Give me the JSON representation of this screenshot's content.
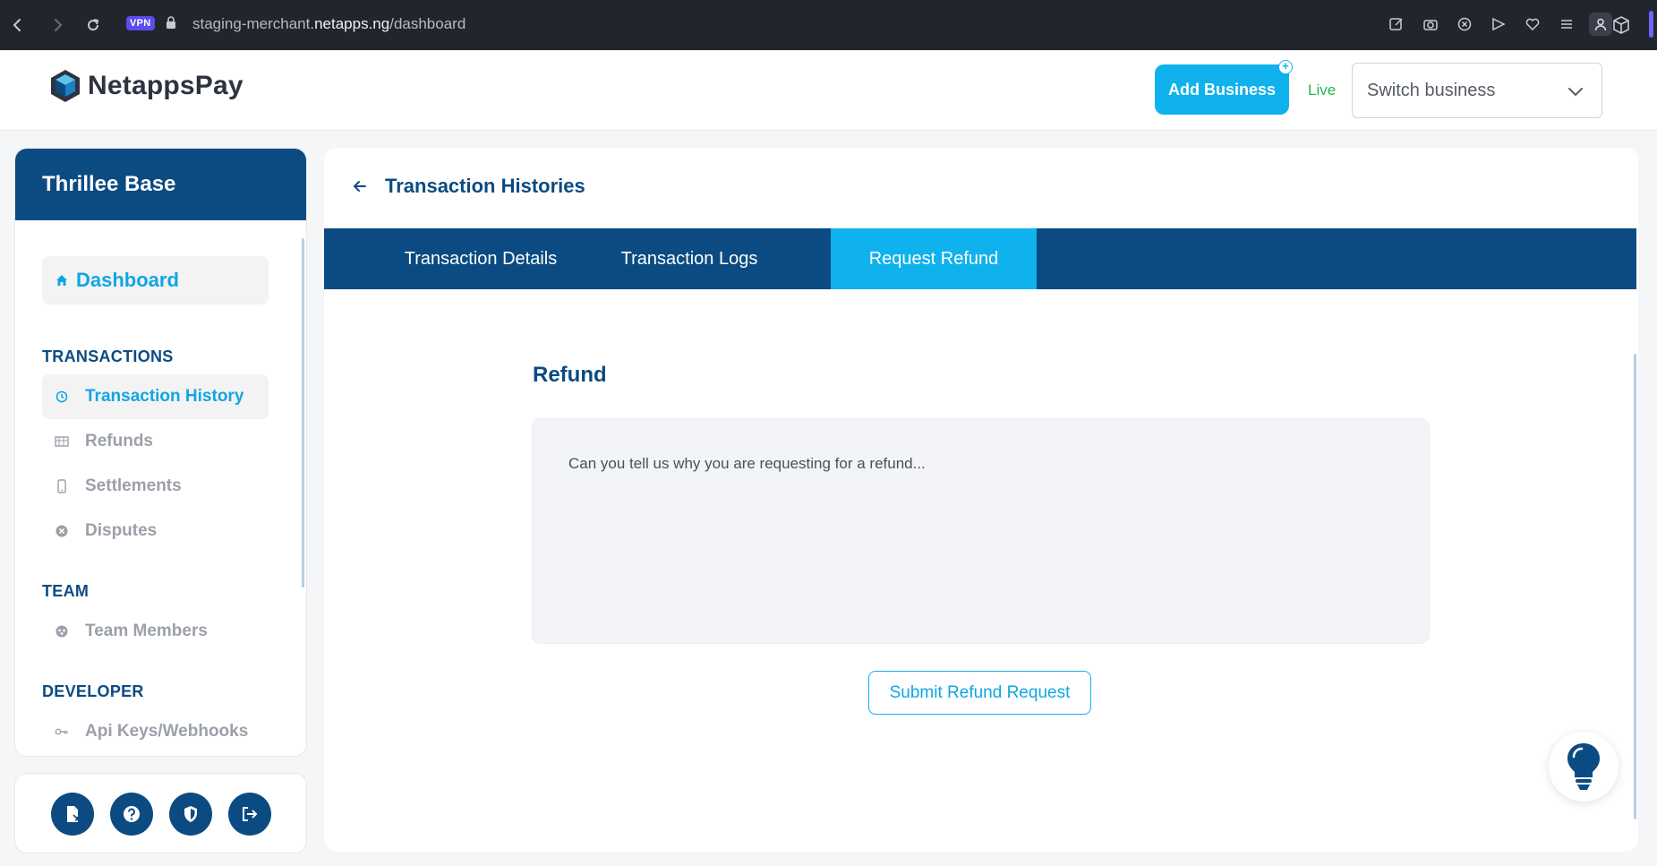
{
  "browser": {
    "vpn_label": "VPN",
    "url_prefix": "staging-merchant.",
    "url_domain": "netapps.ng",
    "url_path": "/dashboard"
  },
  "header": {
    "logo_text": "NetappsPay",
    "add_business_label": "Add Business",
    "plus_badge": "+",
    "mode_label": "Live",
    "switch_business_placeholder": "Switch business"
  },
  "sidebar": {
    "business_name": "Thrillee Base",
    "dashboard_label": "Dashboard",
    "sections": {
      "transactions": "TRANSACTIONS",
      "team": "TEAM",
      "developer": "DEVELOPER"
    },
    "items": {
      "transaction_history": "Transaction History",
      "refunds": "Refunds",
      "settlements": "Settlements",
      "disputes": "Disputes",
      "team_members": "Team Members",
      "api_keys": "Api Keys/Webhooks"
    }
  },
  "main": {
    "title": "Transaction Histories",
    "tabs": [
      "Transaction Details",
      "Transaction Logs",
      "Request Refund"
    ],
    "active_tab": "Request Refund",
    "refund_heading": "Refund",
    "reason_placeholder": "Can you tell us why you are requesting for a refund...",
    "reason_value": "",
    "submit_label": "Submit Refund Request"
  },
  "colors": {
    "brand_navy": "#0b4b82",
    "accent_cyan": "#0fb2ec",
    "live_green": "#25b849"
  }
}
